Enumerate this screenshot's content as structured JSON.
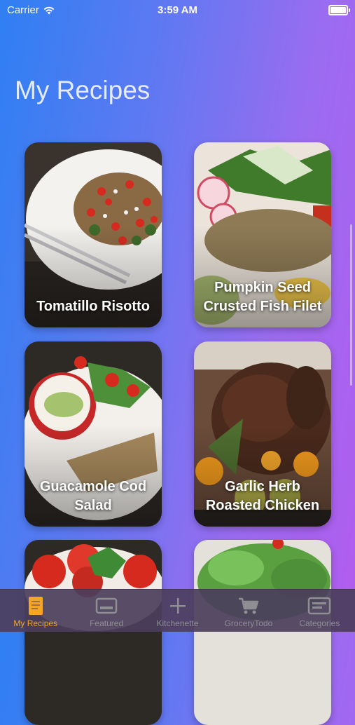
{
  "status_bar": {
    "carrier": "Carrier",
    "time": "3:59 AM"
  },
  "page": {
    "title": "My Recipes"
  },
  "recipes": [
    {
      "name": "Tomatillo Risotto"
    },
    {
      "name": "Pumpkin Seed Crusted Fish Filet"
    },
    {
      "name": "Guacamole Cod Salad"
    },
    {
      "name": "Garlic Herb Roasted Chicken"
    },
    {
      "name": ""
    },
    {
      "name": ""
    }
  ],
  "tabs": [
    {
      "label": "My Recipes",
      "icon": "book-icon",
      "active": true
    },
    {
      "label": "Featured",
      "icon": "card-icon",
      "active": false
    },
    {
      "label": "Kitchenette",
      "icon": "plus-icon",
      "active": false
    },
    {
      "label": "GroceryTodo",
      "icon": "cart-icon",
      "active": false
    },
    {
      "label": "Categories",
      "icon": "list-card-icon",
      "active": false
    }
  ],
  "colors": {
    "accent": "#f5a623",
    "tab_inactive": "#8e8e93"
  }
}
